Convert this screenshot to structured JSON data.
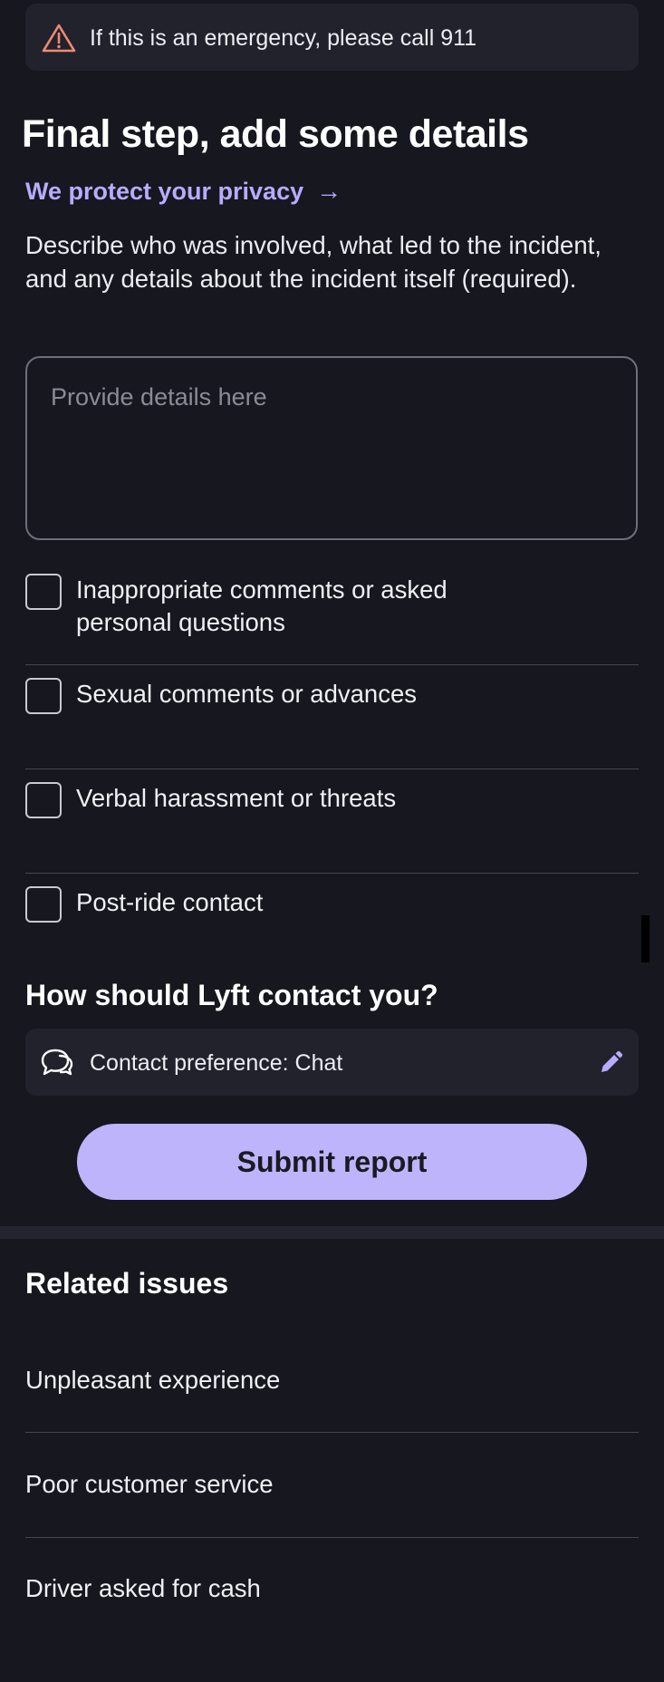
{
  "banner": {
    "icon": "warning-triangle-icon",
    "text": "If this is an emergency, please call 911"
  },
  "header": {
    "title": "Final step, add some details",
    "privacy_link": "We protect your privacy",
    "privacy_arrow": "→"
  },
  "description": "Describe who was involved, what led to the incident, and any details about the incident itself (required).",
  "details_input": {
    "placeholder": "Provide details here",
    "value": ""
  },
  "options": [
    {
      "label": "Inappropriate comments or asked personal questions",
      "checked": false
    },
    {
      "label": "Sexual comments or advances",
      "checked": false
    },
    {
      "label": "Verbal harassment or threats",
      "checked": false
    },
    {
      "label": "Post-ride contact",
      "checked": false
    }
  ],
  "contact": {
    "heading": "How should Lyft contact you?",
    "icon": "chat-bubbles-icon",
    "preference": "Contact preference: Chat",
    "edit_icon": "pencil-icon"
  },
  "submit_label": "Submit report",
  "related": {
    "heading": "Related issues",
    "items": [
      "Unpleasant experience",
      "Poor customer service",
      "Driver asked for cash"
    ]
  },
  "colors": {
    "background": "#16171f",
    "card": "#21222c",
    "accent": "#b7acff",
    "button": "#bdb4fc",
    "warning": "#f08a72"
  }
}
